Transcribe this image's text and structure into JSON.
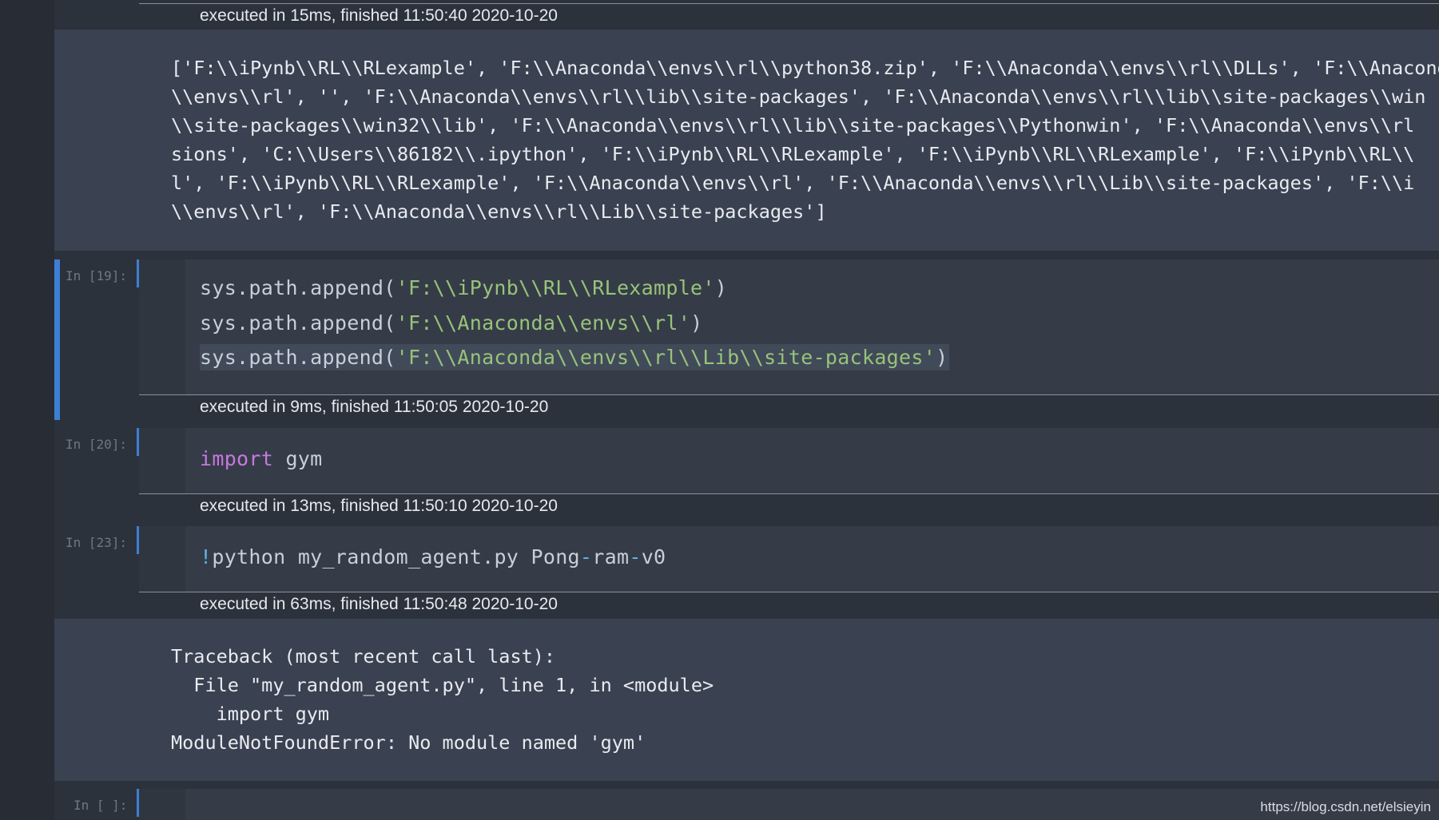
{
  "cells": {
    "c0": {
      "exec": "executed in 15ms, finished 11:50:40 2020-10-20",
      "output": [
        "['F:\\\\iPynb\\\\RL\\\\RLexample', 'F:\\\\Anaconda\\\\envs\\\\rl\\\\python38.zip', 'F:\\\\Anaconda\\\\envs\\\\rl\\\\DLLs', 'F:\\\\Anaconda",
        "\\\\envs\\\\rl', '', 'F:\\\\Anaconda\\\\envs\\\\rl\\\\lib\\\\site-packages', 'F:\\\\Anaconda\\\\envs\\\\rl\\\\lib\\\\site-packages\\\\win",
        "\\\\site-packages\\\\win32\\\\lib', 'F:\\\\Anaconda\\\\envs\\\\rl\\\\lib\\\\site-packages\\\\Pythonwin', 'F:\\\\Anaconda\\\\envs\\\\rl",
        "sions', 'C:\\\\Users\\\\86182\\\\.ipython', 'F:\\\\iPynb\\\\RL\\\\RLexample', 'F:\\\\iPynb\\\\RL\\\\RLexample', 'F:\\\\iPynb\\\\RL\\\\",
        "l', 'F:\\\\iPynb\\\\RL\\\\RLexample', 'F:\\\\Anaconda\\\\envs\\\\rl', 'F:\\\\Anaconda\\\\envs\\\\rl\\\\Lib\\\\site-packages', 'F:\\\\i",
        "\\\\envs\\\\rl', 'F:\\\\Anaconda\\\\envs\\\\rl\\\\Lib\\\\site-packages']"
      ]
    },
    "c19": {
      "prompt": "In [19]:",
      "line1_pre": "sys.path.append(",
      "line1_str": "'F:\\\\iPynb\\\\RL\\\\RLexample'",
      "line1_post": ")",
      "line2_pre": "sys.path.append(",
      "line2_str": "'F:\\\\Anaconda\\\\envs\\\\rl'",
      "line2_post": ")",
      "line3_pre": "sys.path.append(",
      "line3_str": "'F:\\\\Anaconda\\\\envs\\\\rl\\\\Lib\\\\site-packages'",
      "line3_post": ")",
      "exec": "executed in 9ms, finished 11:50:05 2020-10-20"
    },
    "c20": {
      "prompt": "In [20]:",
      "kw": "import",
      "rest": " gym",
      "exec": "executed in 13ms, finished 11:50:10 2020-10-20"
    },
    "c23": {
      "prompt": "In [23]:",
      "bang": "!",
      "cmd_a": "python my_random_agent.py Pong",
      "dash1": "-",
      "cmd_b": "ram",
      "dash2": "-",
      "cmd_c": "v0",
      "exec": "executed in 63ms, finished 11:50:48 2020-10-20",
      "output": [
        "Traceback (most recent call last):",
        "  File \"my_random_agent.py\", line 1, in <module>",
        "    import gym",
        "ModuleNotFoundError: No module named 'gym'"
      ]
    },
    "c_empty": {
      "prompt": "In [ ]:"
    }
  },
  "watermark": "https://blog.csdn.net/elsieyin",
  "colors": {
    "accent": "#3d7fd6",
    "string": "#98c379",
    "keyword": "#c678dd"
  }
}
